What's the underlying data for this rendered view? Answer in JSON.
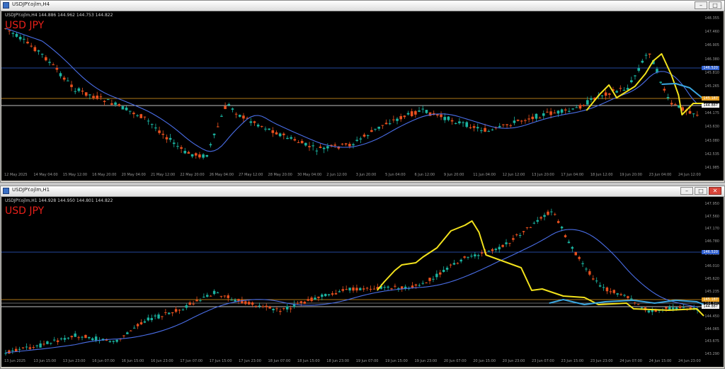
{
  "panes": [
    {
      "id": "h4",
      "title": "USDJPY.ojlm,H4",
      "ohlc": "USDJPY.ojlm,H4  144.886 144.962 144.753 144.822",
      "pair_label": "USD JPY",
      "timeframe_label": "H4",
      "timeframe_color": "#f0a020",
      "window_buttons": [
        "–",
        "□"
      ],
      "price_labels": [
        "148.355",
        "147.460",
        "146.905",
        "146.380",
        "145.810",
        "145.265",
        "144.720",
        "144.175",
        "143.630",
        "143.080",
        "142.535",
        "141.985"
      ],
      "highlighted_prices": [
        {
          "value": "146.520",
          "color": "#3060d0"
        },
        {
          "value": "145.187",
          "color": "#e8a020"
        },
        {
          "value": "144.887",
          "color": "#ffffff"
        }
      ],
      "time_labels": [
        "12 May 2025",
        "14 May 04:00",
        "15 May 12:00",
        "16 May 20:00",
        "20 May 04:00",
        "21 May 12:00",
        "22 May 20:00",
        "26 May 04:00",
        "27 May 12:00",
        "28 May 20:00",
        "30 May 04:00",
        "2 Jun 12:00",
        "3 Jun 20:00",
        "5 Jun 04:00",
        "6 Jun 12:00",
        "9 Jun 20:00",
        "11 Jun 04:00",
        "12 Jun 12:00",
        "13 Jun 20:00",
        "17 Jun 04:00",
        "18 Jun 12:00",
        "19 Jun 20:00",
        "23 Jun 04:00",
        "24 Jun 12:00"
      ]
    },
    {
      "id": "h1",
      "title": "USDJPY.ojlm,H1",
      "ohlc": "USDJPY.ojlm,H1  144.928 144.950 144.801 144.822",
      "pair_label": "USD JPY",
      "timeframe_label": "H1",
      "timeframe_color": "#3aa6b0",
      "window_buttons": [
        "–",
        "□",
        "✕"
      ],
      "price_labels": [
        "147.950",
        "147.560",
        "147.170",
        "146.780",
        "146.395",
        "146.010",
        "145.620",
        "145.235",
        "144.840",
        "144.450",
        "144.065",
        "143.675",
        "143.290"
      ],
      "highlighted_prices": [
        {
          "value": "146.520",
          "color": "#3060d0"
        },
        {
          "value": "145.187",
          "color": "#e8a020"
        },
        {
          "value": "144.887",
          "color": "#ffffff"
        }
      ],
      "time_labels": [
        "13 Jun 2025",
        "13 Jun 15:00",
        "13 Jun 23:00",
        "16 Jun 07:00",
        "16 Jun 15:00",
        "16 Jun 23:00",
        "17 Jun 07:00",
        "17 Jun 15:00",
        "17 Jun 23:00",
        "18 Jun 07:00",
        "18 Jun 15:00",
        "18 Jun 23:00",
        "19 Jun 07:00",
        "19 Jun 15:00",
        "19 Jun 23:00",
        "20 Jun 07:00",
        "20 Jun 15:00",
        "20 Jun 23:00",
        "23 Jun 07:00",
        "23 Jun 15:00",
        "23 Jun 23:00",
        "24 Jun 07:00",
        "24 Jun 15:00",
        "24 Jun 23:00"
      ]
    }
  ],
  "colors": {
    "bull_candle": "#1ab3a0",
    "bear_candle": "#e8501e",
    "moving_average": "#4a6ee8",
    "annotation_path": "#f2e21c",
    "forecast_path": "#3aa6e0"
  }
}
